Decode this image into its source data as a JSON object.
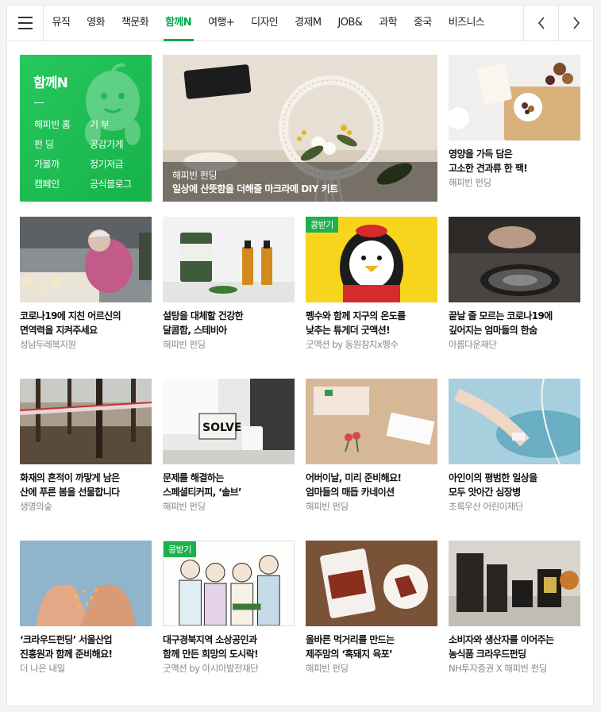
{
  "nav": {
    "tabs": [
      "뮤직",
      "영화",
      "책문화",
      "함께N",
      "여행+",
      "디자인",
      "경제M",
      "JOB&",
      "과학",
      "중국",
      "비즈니스"
    ],
    "active_index": 3
  },
  "colors": {
    "accent": "#03a94a",
    "panel": "#1cb14b",
    "badge": "#1cb14b"
  },
  "panel": {
    "title": "함께N",
    "links": [
      "해피빈 홈",
      "기 부",
      "펀 딩",
      "공감가게",
      "가볼까",
      "정기저금",
      "캠페인",
      "공식블로그"
    ]
  },
  "feature": {
    "source": "해피빈 펀딩",
    "title": "일상에 산뜻함을 더해줄 마크라메 DIY 키트"
  },
  "cards": [
    {
      "title": "영양을 가득 담은\n고소한 견과류 한 팩!",
      "source": "해피빈 펀딩",
      "badge": ""
    },
    {
      "title": "코로나19에 지친 어르신의\n면역력을 지켜주세요",
      "source": "성남두레복지원",
      "badge": ""
    },
    {
      "title": "설탕을 대체할 건강한\n달콤함, 스테비아",
      "source": "해피빈 펀딩",
      "badge": ""
    },
    {
      "title": "펭수와 함께 지구의 온도를\n낮추는 튜게더 굿액션!",
      "source": "굿액션 by 동원참치x펭수",
      "badge": "콩받기"
    },
    {
      "title": "끝날 줄 모르는 코로나19에\n깊어지는 엄마들의 한숨",
      "source": "아름다운재단",
      "badge": ""
    },
    {
      "title": "화재의 흔적이 까맣게 남은\n산에 푸른 봄을 선물합니다",
      "source": "생명의숲",
      "badge": ""
    },
    {
      "title": "문제를 해결하는\n스페셜티커피, ‘솔브’",
      "source": "해피빈 펀딩",
      "badge": ""
    },
    {
      "title": "어버이날, 미리 준비해요!\n엄마들의 매듭 카네이션",
      "source": "해피빈 펀딩",
      "badge": ""
    },
    {
      "title": "아인이의 평범한 일상을\n모두 앗아간 심장병",
      "source": "초록우산 어린이재단",
      "badge": ""
    },
    {
      "title": "‘크라우드펀딩’ 서울산업\n진흥원과 함께 준비해요!",
      "source": "더 나은 내일",
      "badge": ""
    },
    {
      "title": "대구경북지역 소상공인과\n함께 만든 희망의 도시락!",
      "source": "굿액션 by 아시아발전재단",
      "badge": "콩받기"
    },
    {
      "title": "올바른 먹거리를 만드는\n제주맘의 ‘흑돼지 육포’",
      "source": "해피빈 펀딩",
      "badge": ""
    },
    {
      "title": "소비자와 생산자를 이어주는\n농식품 크라우드펀딩",
      "source": "NH투자증권 X 해피빈 펀딩",
      "badge": ""
    }
  ]
}
